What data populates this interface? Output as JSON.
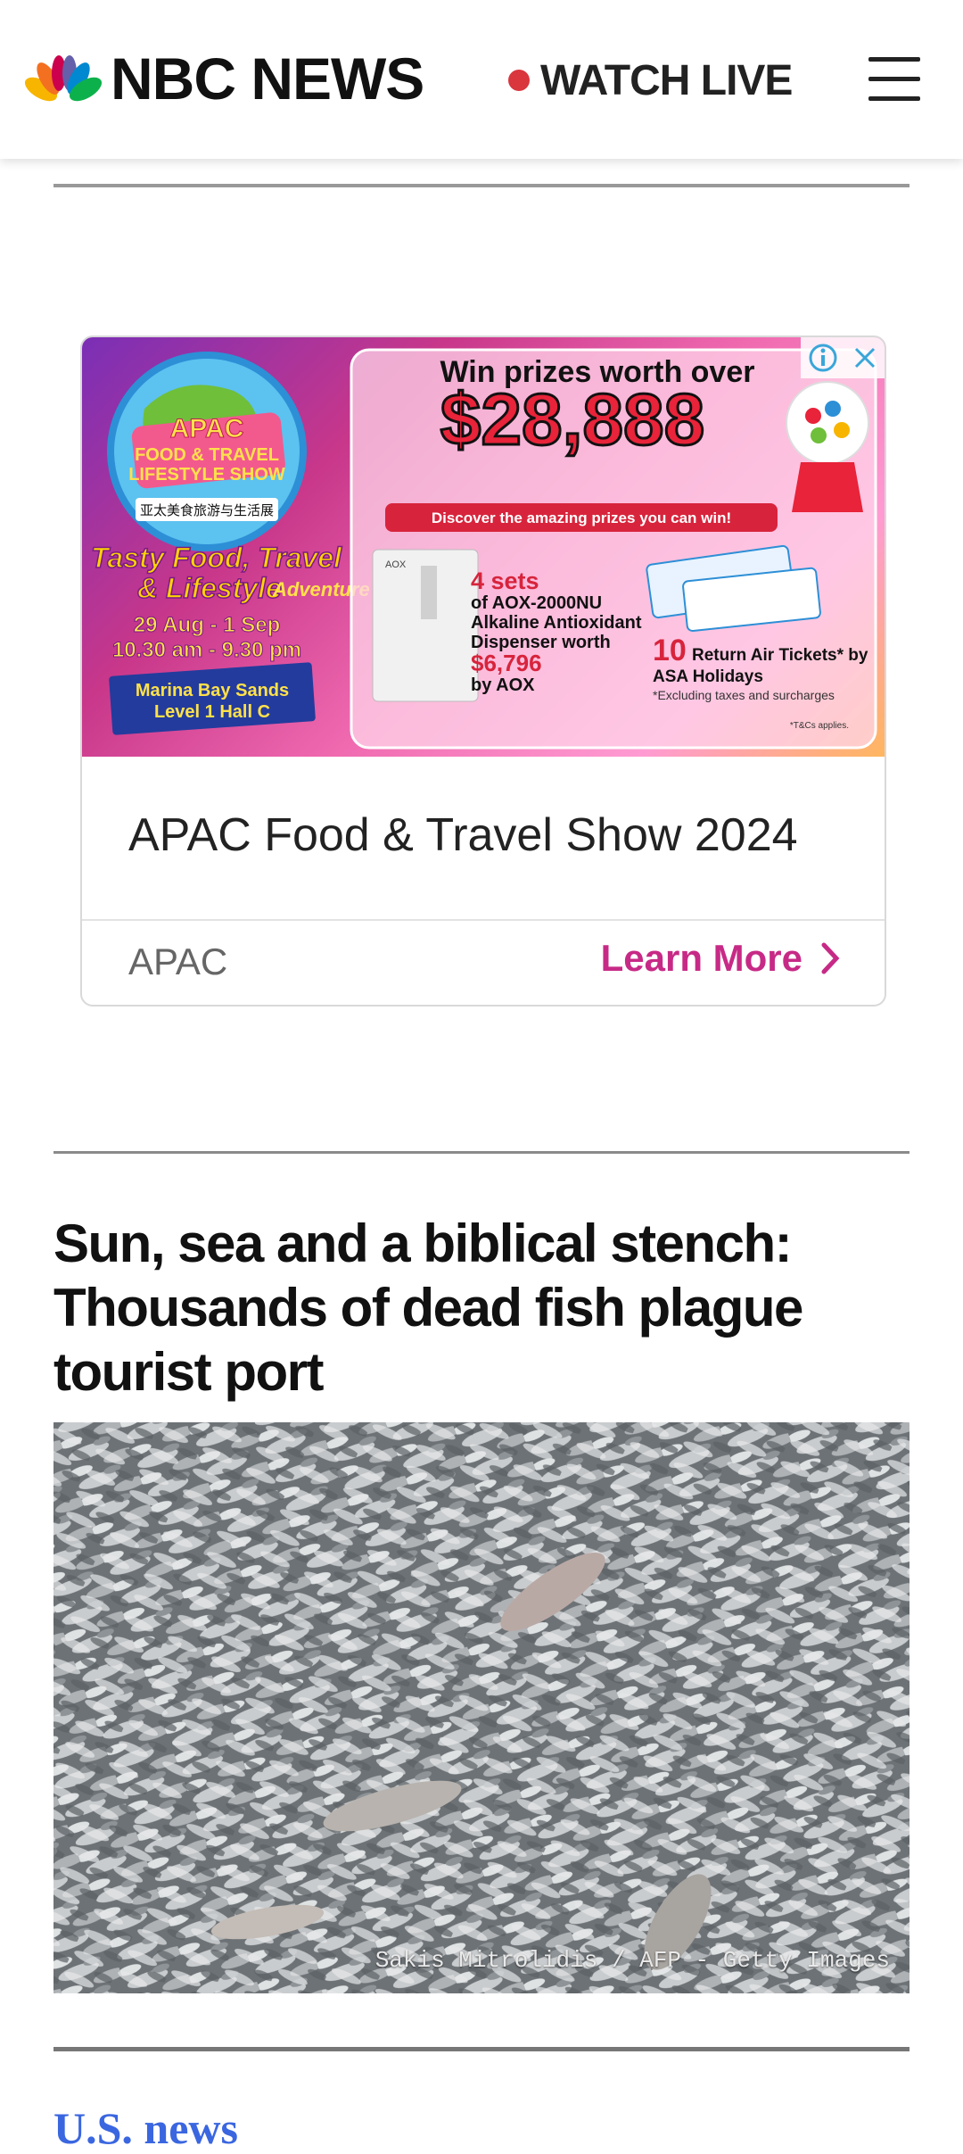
{
  "header": {
    "brand": "NBC NEWS",
    "live_label": "WATCH LIVE",
    "live_dot_color": "#d9363e",
    "menu_icon": "hamburger-menu-icon",
    "logo_icon": "nbc-peacock-icon"
  },
  "ad": {
    "banner": {
      "show_badge_lines": [
        "APAC",
        "FOOD & TRAVEL",
        "LIFESTYLE SHOW"
      ],
      "show_badge_chinese": "亚太美食旅游与生活展",
      "tagline_1": "Tasty Food, Travel",
      "tagline_2": "& Lifestyle",
      "tagline_3": "Adventure",
      "dates": "29 Aug - 1 Sep",
      "hours": "10.30 am - 9.30 pm",
      "venue_1": "Marina Bay Sands",
      "venue_2": "Level 1 Hall C",
      "prize_intro": "Win prizes worth over",
      "prize_amount": "$28,888",
      "prize_cta": "Discover the amazing prizes you can win!",
      "prize1_count": "4 sets",
      "prize1_desc_1": "of AOX-2000NU",
      "prize1_desc_2": "Alkaline Antioxidant",
      "prize1_desc_3": "Dispenser worth",
      "prize1_value": "$6,796",
      "prize1_by": "by AOX",
      "prize1_brand": "AOX",
      "prize2_count": "10",
      "prize2_desc_1": "Return Air Tickets* by",
      "prize2_desc_2": "ASA Holidays",
      "prize2_note": "*Excluding taxes and surcharges",
      "tcs": "*T&Cs applies."
    },
    "title": "APAC Food & Travel Show 2024",
    "sponsor": "APAC",
    "cta": "Learn More",
    "cta_color": "#c72a86"
  },
  "story": {
    "headline": "Sun, sea and a biblical stench: Thousands of dead fish plague tourist port",
    "image_credit": "Sakis Mitrolidis / AFP - Getty Images"
  },
  "next_section": {
    "label": "U.S. news",
    "color": "#3a66e0"
  }
}
